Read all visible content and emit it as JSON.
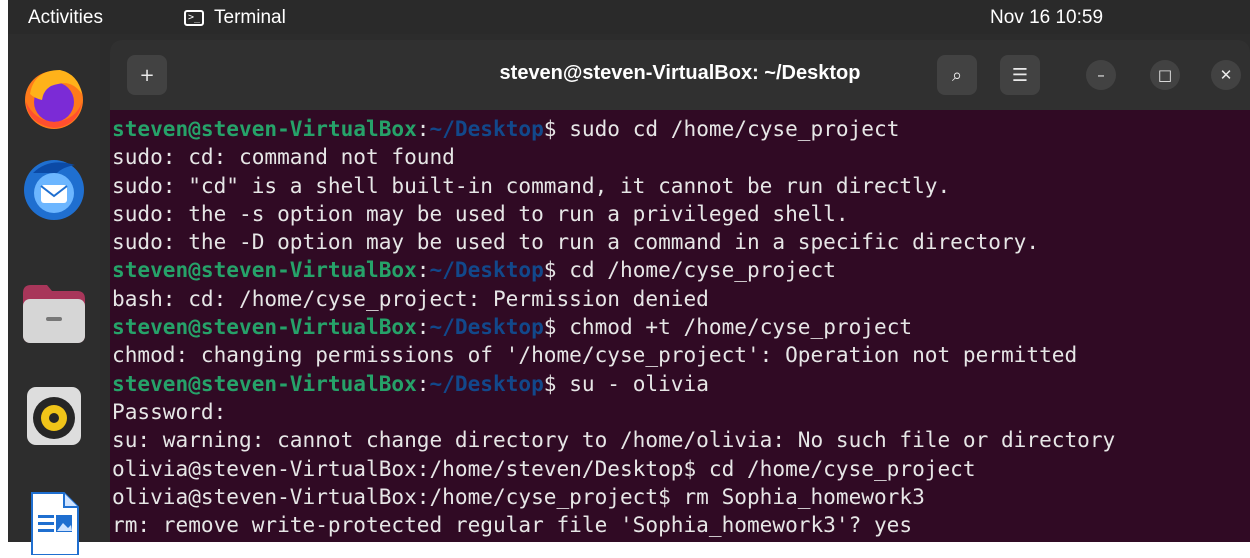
{
  "topbar": {
    "activities": "Activities",
    "app_name": "Terminal",
    "app_icon_glyph": ">_",
    "clock": "Nov 16  10:59"
  },
  "dock": {
    "items": [
      "firefox-icon",
      "thunderbird-icon",
      "files-icon",
      "rhythmbox-icon",
      "libreoffice-writer-icon"
    ]
  },
  "window": {
    "title": "steven@steven-VirtualBox: ~/Desktop",
    "buttons": {
      "new_tab": "+",
      "search": "⌕",
      "menu": "☰",
      "minimize": "–",
      "maximize": "□",
      "close": "✕"
    }
  },
  "terminal": {
    "colors": {
      "background": "#300a24",
      "user_host": "#26a269",
      "path": "#12488b",
      "text": "#e6e6e6"
    },
    "lines": [
      {
        "type": "prompt",
        "user": "steven@steven-VirtualBox",
        "sep": ":",
        "path": "~/Desktop",
        "sym": "$ ",
        "cmd": "sudo cd /home/cyse_project"
      },
      {
        "type": "out",
        "text": "sudo: cd: command not found"
      },
      {
        "type": "out",
        "text": "sudo: \"cd\" is a shell built-in command, it cannot be run directly."
      },
      {
        "type": "out",
        "text": "sudo: the -s option may be used to run a privileged shell."
      },
      {
        "type": "out",
        "text": "sudo: the -D option may be used to run a command in a specific directory."
      },
      {
        "type": "prompt",
        "user": "steven@steven-VirtualBox",
        "sep": ":",
        "path": "~/Desktop",
        "sym": "$ ",
        "cmd": "cd /home/cyse_project"
      },
      {
        "type": "out",
        "text": "bash: cd: /home/cyse_project: Permission denied"
      },
      {
        "type": "prompt",
        "user": "steven@steven-VirtualBox",
        "sep": ":",
        "path": "~/Desktop",
        "sym": "$ ",
        "cmd": "chmod +t /home/cyse_project"
      },
      {
        "type": "out",
        "text": "chmod: changing permissions of '/home/cyse_project': Operation not permitted"
      },
      {
        "type": "prompt",
        "user": "steven@steven-VirtualBox",
        "sep": ":",
        "path": "~/Desktop",
        "sym": "$ ",
        "cmd": "su - olivia"
      },
      {
        "type": "out",
        "text": "Password:"
      },
      {
        "type": "out",
        "text": "su: warning: cannot change directory to /home/olivia: No such file or directory"
      },
      {
        "type": "out",
        "text": "olivia@steven-VirtualBox:/home/steven/Desktop$ cd /home/cyse_project"
      },
      {
        "type": "out",
        "text": "olivia@steven-VirtualBox:/home/cyse_project$ rm Sophia_homework3"
      },
      {
        "type": "out",
        "text": "rm: remove write-protected regular file 'Sophia_homework3'? yes"
      }
    ]
  }
}
